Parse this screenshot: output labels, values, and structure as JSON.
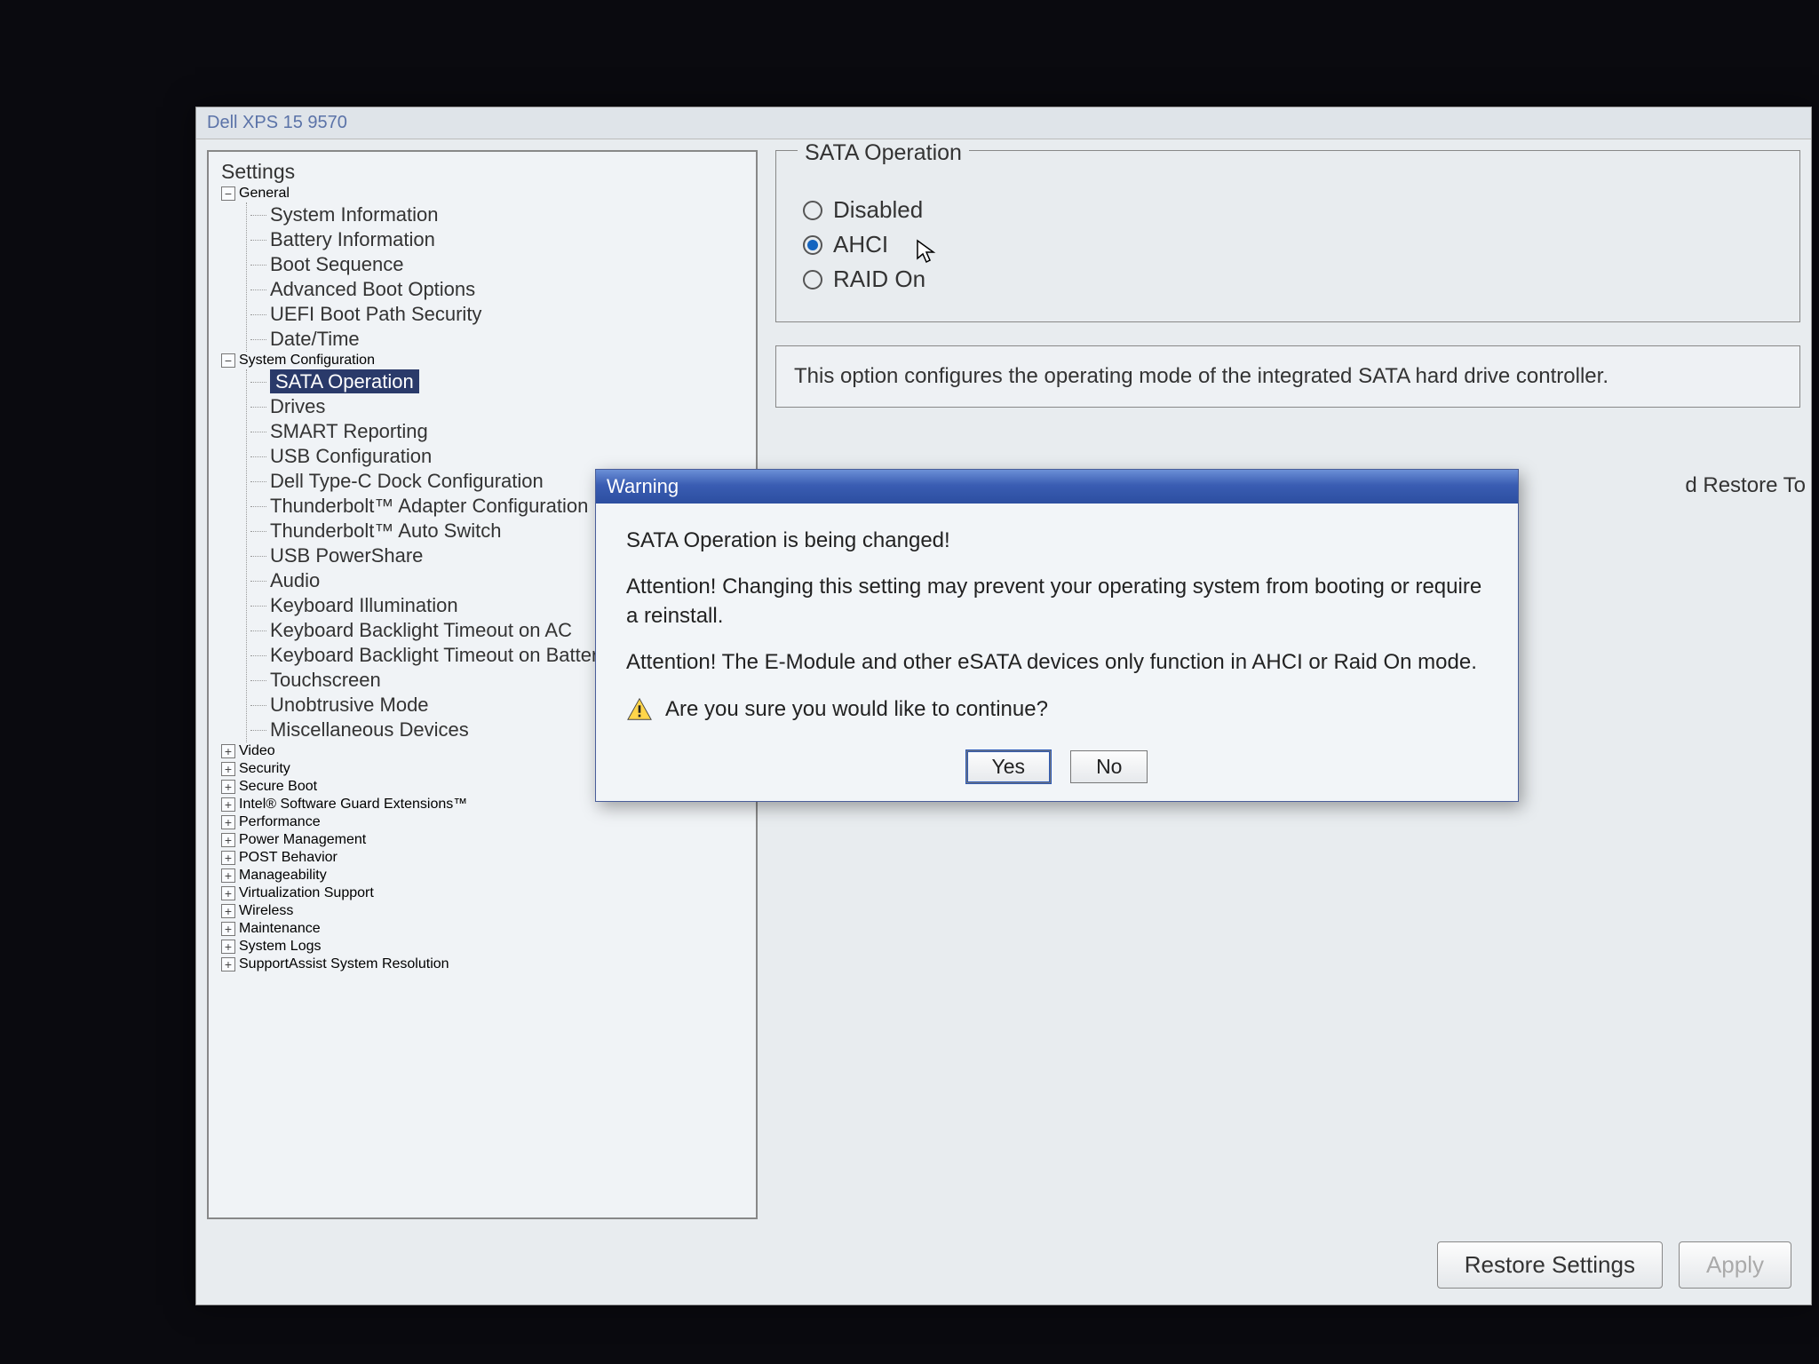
{
  "window_title": "Dell XPS 15 9570",
  "tree": {
    "root_label": "Settings",
    "categories": [
      {
        "label": "General",
        "expanded": true,
        "children": [
          "System Information",
          "Battery Information",
          "Boot Sequence",
          "Advanced Boot Options",
          "UEFI Boot Path Security",
          "Date/Time"
        ]
      },
      {
        "label": "System Configuration",
        "expanded": true,
        "children": [
          "SATA Operation",
          "Drives",
          "SMART Reporting",
          "USB Configuration",
          "Dell Type-C Dock Configuration",
          "Thunderbolt™ Adapter Configuration",
          "Thunderbolt™ Auto Switch",
          "USB PowerShare",
          "Audio",
          "Keyboard Illumination",
          "Keyboard Backlight Timeout on AC",
          "Keyboard Backlight Timeout on Battery",
          "Touchscreen",
          "Unobtrusive Mode",
          "Miscellaneous Devices"
        ],
        "selected_index": 0
      },
      {
        "label": "Video",
        "expanded": false
      },
      {
        "label": "Security",
        "expanded": false
      },
      {
        "label": "Secure Boot",
        "expanded": false
      },
      {
        "label": "Intel® Software Guard Extensions™",
        "expanded": false
      },
      {
        "label": "Performance",
        "expanded": false
      },
      {
        "label": "Power Management",
        "expanded": false
      },
      {
        "label": "POST Behavior",
        "expanded": false
      },
      {
        "label": "Manageability",
        "expanded": false
      },
      {
        "label": "Virtualization Support",
        "expanded": false
      },
      {
        "label": "Wireless",
        "expanded": false
      },
      {
        "label": "Maintenance",
        "expanded": false
      },
      {
        "label": "System Logs",
        "expanded": false
      },
      {
        "label": "SupportAssist System Resolution",
        "expanded": false
      }
    ]
  },
  "content": {
    "group_title": "SATA Operation",
    "options": [
      {
        "label": "Disabled",
        "checked": false
      },
      {
        "label": "AHCI",
        "checked": true
      },
      {
        "label": "RAID On",
        "checked": false
      }
    ],
    "description": "This option configures the operating mode of the integrated SATA hard drive controller.",
    "truncated_right": "d Restore To"
  },
  "dialog": {
    "title": "Warning",
    "heading": "SATA Operation is being changed!",
    "para1": "Attention!  Changing this setting may prevent your operating system from booting or require a reinstall.",
    "para2": "Attention!  The E-Module and other eSATA devices only function in AHCI or Raid On mode.",
    "confirm": "Are you sure you would like to continue?",
    "yes": "Yes",
    "no": "No"
  },
  "footer": {
    "restore": "Restore Settings",
    "apply": "Apply"
  }
}
